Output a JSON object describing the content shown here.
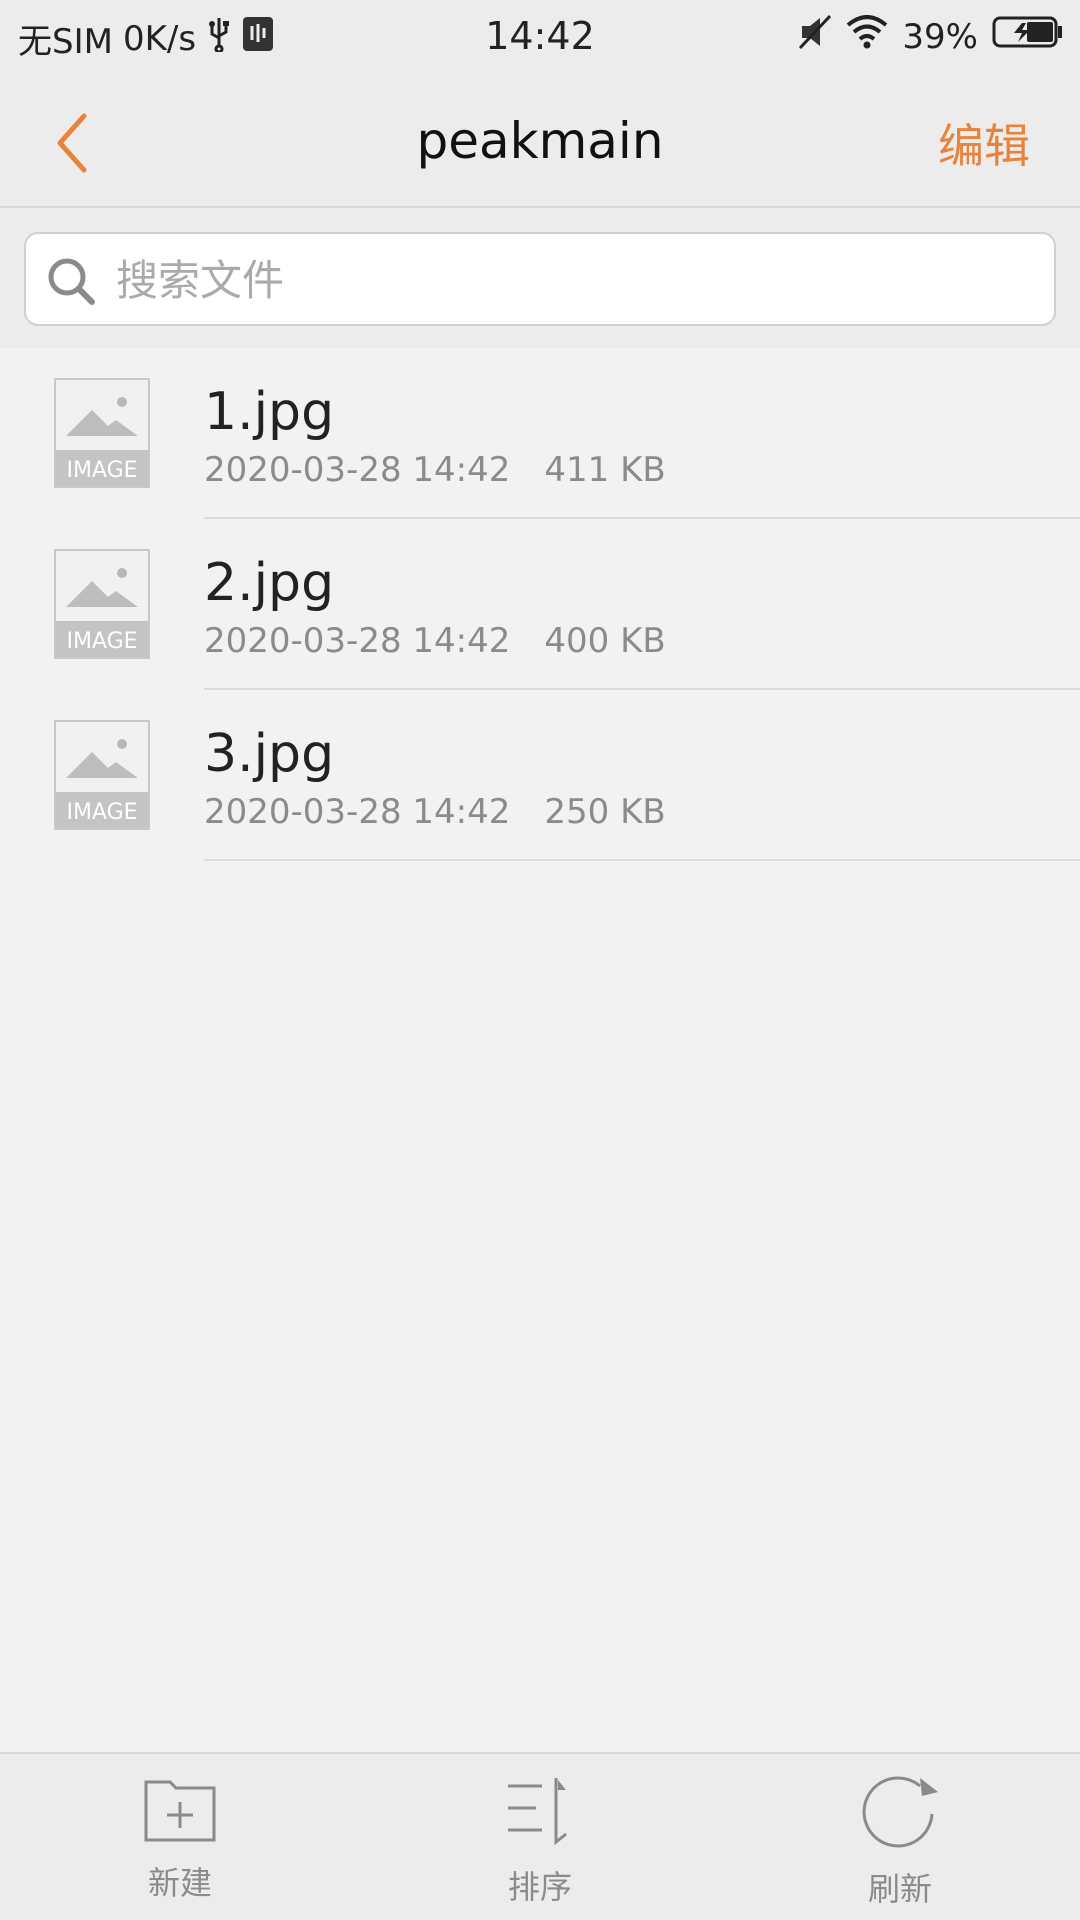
{
  "status_bar": {
    "sim": "无SIM",
    "speed": "0K/s",
    "time": "14:42",
    "battery": "39%"
  },
  "header": {
    "title": "peakmain",
    "edit_label": "编辑"
  },
  "search": {
    "placeholder": "搜索文件"
  },
  "files": [
    {
      "name": "1.jpg",
      "date": "2020-03-28 14:42",
      "size": "411 KB",
      "thumb_label": "IMAGE"
    },
    {
      "name": "2.jpg",
      "date": "2020-03-28 14:42",
      "size": "400 KB",
      "thumb_label": "IMAGE"
    },
    {
      "name": "3.jpg",
      "date": "2020-03-28 14:42",
      "size": "250 KB",
      "thumb_label": "IMAGE"
    }
  ],
  "toolbar": {
    "new_label": "新建",
    "sort_label": "排序",
    "refresh_label": "刷新"
  },
  "colors": {
    "accent": "#e8833a",
    "background": "#f2f2f2"
  },
  "icons": {
    "back": "chevron-left-icon",
    "search": "search-icon",
    "thumb": "image-placeholder-icon",
    "new": "new-folder-icon",
    "sort": "sort-icon",
    "refresh": "refresh-icon"
  }
}
